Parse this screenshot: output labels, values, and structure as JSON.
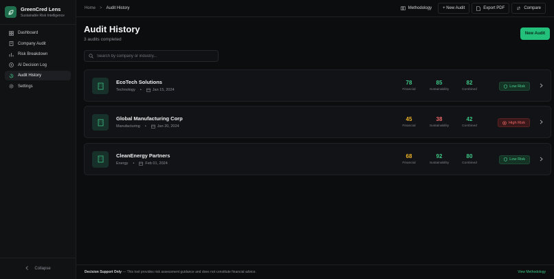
{
  "brand": {
    "title": "GreenCred Lens",
    "subtitle": "Sustainable Risk Intelligence"
  },
  "sidebar": {
    "items": [
      {
        "label": "Dashboard",
        "icon": "grid-icon"
      },
      {
        "label": "Company Audit",
        "icon": "building-icon"
      },
      {
        "label": "Risk Breakdown",
        "icon": "bar-chart-icon"
      },
      {
        "label": "AI Decision Log",
        "icon": "log-icon"
      },
      {
        "label": "Audit History",
        "icon": "history-icon",
        "active": true
      },
      {
        "label": "Settings",
        "icon": "gear-icon"
      }
    ],
    "collapse_label": "Collapse"
  },
  "breadcrumb": {
    "home": "Home",
    "separator": ">",
    "current": "Audit History"
  },
  "toolbar": {
    "methodology": "Methodology",
    "new_audit": "+ New Audit",
    "export_pdf": "Export PDF",
    "compare": "Compare"
  },
  "main": {
    "title": "Audit History",
    "subtitle": "3 audits completed",
    "new_audit_button": "New Audit",
    "search_placeholder": "Search by company or industry..."
  },
  "audits": [
    {
      "name": "EcoTech Solutions",
      "industry": "Technology",
      "date": "Jan 15, 2024",
      "financial": "78",
      "sustainability": "85",
      "combined": "82",
      "financial_color": "#3ec887",
      "sustainability_color": "#3ec887",
      "combined_color": "#3ec887",
      "risk": "Low Risk",
      "risk_level": "low"
    },
    {
      "name": "Global Manufacturing Corp",
      "industry": "Manufacturing",
      "date": "Jan 20, 2024",
      "financial": "45",
      "sustainability": "38",
      "combined": "42",
      "financial_color": "#f0b429",
      "sustainability_color": "#f06a6a",
      "combined_color": "#3ec887",
      "risk": "High Risk",
      "risk_level": "high"
    },
    {
      "name": "CleanEnergy Partners",
      "industry": "Energy",
      "date": "Feb 01, 2024",
      "financial": "68",
      "sustainability": "92",
      "combined": "80",
      "financial_color": "#f0b429",
      "sustainability_color": "#3ec887",
      "combined_color": "#3ec887",
      "risk": "Low Risk",
      "risk_level": "low"
    }
  ],
  "score_labels": {
    "financial": "Financial",
    "sustainability": "Sustainability",
    "combined": "Combined"
  },
  "footer": {
    "bold": "Decision Support Only",
    "text": " — This tool provides risk assessment guidance and does not constitute financial advice.",
    "link": "View Methodology"
  },
  "colors": {
    "accent": "#22c07b",
    "background": "#0c0d0f",
    "low_risk": "#49d391",
    "high_risk": "#f06a6a"
  }
}
